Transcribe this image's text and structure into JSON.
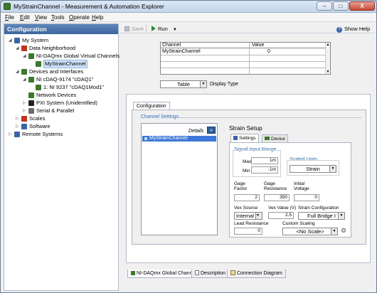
{
  "window": {
    "title": "MyStrainChannel - Measurement & Automation Explorer",
    "min": "–",
    "max": "□",
    "close": "X"
  },
  "menu": [
    "File",
    "Edit",
    "View",
    "Tools",
    "Operate",
    "Help"
  ],
  "config_panel": {
    "title": "Configuration"
  },
  "tree": [
    {
      "label": "My System",
      "depth": 0,
      "icon_color": "#3a64a8",
      "expanded": true
    },
    {
      "label": "Data Neighborhood",
      "depth": 1,
      "icon_color": "#c7301d",
      "expanded": true
    },
    {
      "label": "NI-DAQmx Global Virtual Channels",
      "depth": 2,
      "icon_color": "#3b7a2b",
      "expanded": true
    },
    {
      "label": "MyStrainChannel",
      "depth": 3,
      "icon_color": "#3b7a2b",
      "selected": true
    },
    {
      "label": "Devices and Interfaces",
      "depth": 1,
      "icon_color": "#3b7a2b",
      "expanded": true
    },
    {
      "label": "NI cDAQ-9174 \"cDAQ1\"",
      "depth": 2,
      "icon_color": "#3b7a2b",
      "expanded": true
    },
    {
      "label": "1: NI 9237 \"cDAQ1Mod1\"",
      "depth": 3,
      "icon_color": "#3b7a2b"
    },
    {
      "label": "Network Devices",
      "depth": 2,
      "icon_color": "#3b7a2b"
    },
    {
      "label": "PXI System (Unidentified)",
      "depth": 2,
      "icon_color": "#222222",
      "collapsed": true
    },
    {
      "label": "Serial & Parallel",
      "depth": 2,
      "icon_color": "#6b6b6b",
      "collapsed": true
    },
    {
      "label": "Scales",
      "depth": 1,
      "icon_color": "#c7301d",
      "collapsed": true
    },
    {
      "label": "Software",
      "depth": 1,
      "icon_color": "#3a64a8",
      "collapsed": true
    },
    {
      "label": "Remote Systems",
      "depth": 0,
      "icon_color": "#3a64a8",
      "collapsed": true
    }
  ],
  "toolbar": {
    "save": "Save",
    "run": "Run",
    "show_help": "Show Help"
  },
  "table": {
    "col_channel": "Channel",
    "col_value": "Value",
    "rows": [
      {
        "channel": "MyStrainChannel",
        "value": "0"
      }
    ]
  },
  "display_type": {
    "value": "Table",
    "label": "Display Type"
  },
  "config_tab": "Configuration",
  "channel_settings": {
    "label": "Channel Settings",
    "details": "Details",
    "channels": [
      "MyStrainChannel"
    ]
  },
  "strain_setup": {
    "title": "Strain Setup",
    "tab_settings": "Settings",
    "tab_device": "Device",
    "signal_input_range": "Signal Input Range",
    "max_label": "Max",
    "max_value": "1m",
    "min_label": "Min",
    "min_value": "-1m",
    "scaled_units_label": "Scaled Units",
    "scaled_units": "Strain",
    "gage_factor_label": "Gage Factor",
    "gage_factor": "2",
    "gage_resistance_label": "Gage Resistance",
    "gage_resistance": "350",
    "initial_voltage_label": "Initial Voltage",
    "initial_voltage": "0",
    "vex_source_label": "Vex Source",
    "vex_source": "Internal",
    "vex_value_label": "Vex Value (V)",
    "vex_value": "2.5",
    "strain_config_label": "Strain Configuration",
    "strain_config": "Full Bridge I",
    "lead_resistance_label": "Lead Resistance",
    "lead_resistance": "0",
    "custom_scaling_label": "Custom Scaling",
    "custom_scaling": "<No Scale>"
  },
  "bottom_tabs": [
    "NI-DAQmx Global Channel",
    "Description",
    "Connection Diagram"
  ]
}
